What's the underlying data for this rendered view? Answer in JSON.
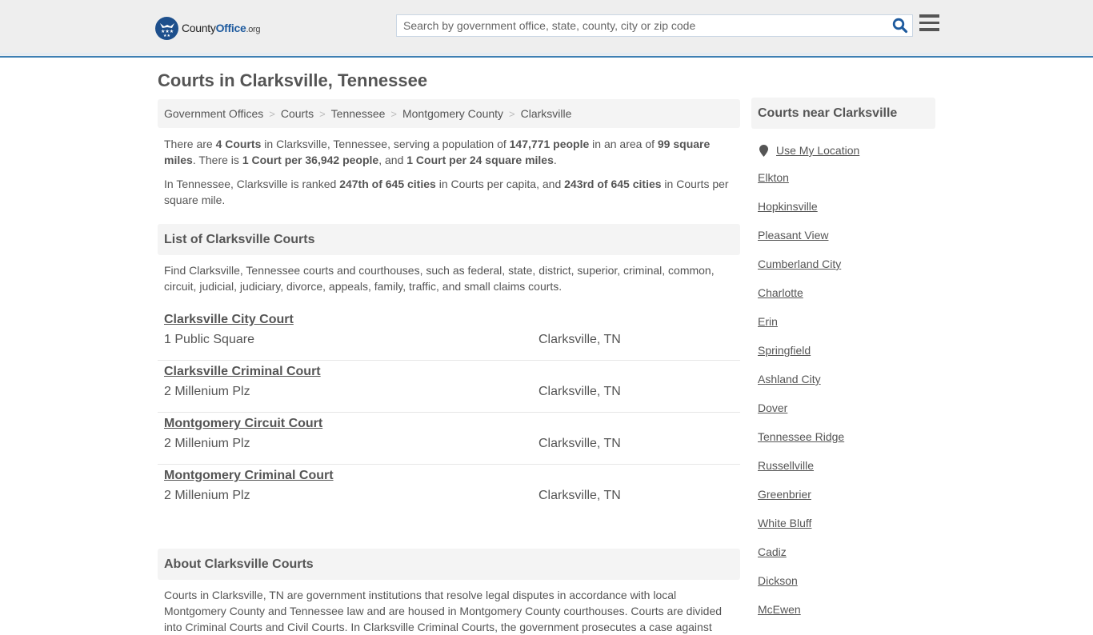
{
  "header": {
    "logo": {
      "part1": "County",
      "part2": "Office",
      "part3": ".org"
    },
    "search": {
      "placeholder": "Search by government office, state, county, city or zip code",
      "value": ""
    },
    "icons": {
      "search": "search-icon",
      "menu": "hamburger-menu-icon",
      "logo": "eagle-stars-badge-icon"
    },
    "accent_color": "#3d7fb3"
  },
  "page": {
    "title": "Courts in Clarksville, Tennessee"
  },
  "breadcrumb": [
    {
      "label": "Government Offices"
    },
    {
      "label": "Courts"
    },
    {
      "label": "Tennessee"
    },
    {
      "label": "Montgomery County"
    },
    {
      "label": "Clarksville"
    }
  ],
  "breadcrumb_separator": ">",
  "summary": {
    "p1": {
      "t1": "There are ",
      "b1": "4 Courts",
      "t2": " in Clarksville, Tennessee, serving a population of ",
      "b2": "147,771 people",
      "t3": " in an area of ",
      "b3": "99 square miles",
      "t4": ". There is ",
      "b4": "1 Court per 36,942 people",
      "t5": ", and ",
      "b5": "1 Court per 24 square miles",
      "t6": "."
    },
    "p2": {
      "t1": "In Tennessee, Clarksville is ranked ",
      "b1": "247th of 645 cities",
      "t2": " in Courts per capita, and ",
      "b2": "243rd of 645 cities",
      "t3": " in Courts per square mile."
    }
  },
  "list_section": {
    "heading": "List of Clarksville Courts",
    "description": "Find Clarksville, Tennessee courts and courthouses, such as federal, state, district, superior, criminal, common, circuit, judicial, judiciary, divorce, appeals, family, traffic, and small claims courts.",
    "courts": [
      {
        "name": "Clarksville City Court",
        "address": "1 Public Square",
        "city": "Clarksville, TN"
      },
      {
        "name": "Clarksville Criminal Court",
        "address": "2 Millenium Plz",
        "city": "Clarksville, TN"
      },
      {
        "name": "Montgomery Circuit Court",
        "address": "2 Millenium Plz",
        "city": "Clarksville, TN"
      },
      {
        "name": "Montgomery Criminal Court",
        "address": "2 Millenium Plz",
        "city": "Clarksville, TN"
      }
    ]
  },
  "about_section": {
    "heading": "About Clarksville Courts",
    "text": "Courts in Clarksville, TN are government institutions that resolve legal disputes in accordance with local Montgomery County and Tennessee law and are housed in Montgomery County courthouses. Courts are divided into Criminal Courts and Civil Courts. In Clarksville Criminal Courts, the government prosecutes a case against"
  },
  "sidebar": {
    "heading": "Courts near Clarksville",
    "use_location": "Use My Location",
    "location_icon": "map-pin-icon",
    "nearby": [
      "Elkton",
      "Hopkinsville",
      "Pleasant View",
      "Cumberland City",
      "Charlotte",
      "Erin",
      "Springfield",
      "Ashland City",
      "Dover",
      "Tennessee Ridge",
      "Russellville",
      "Greenbrier",
      "White Bluff",
      "Cadiz",
      "Dickson",
      "McEwen"
    ]
  }
}
